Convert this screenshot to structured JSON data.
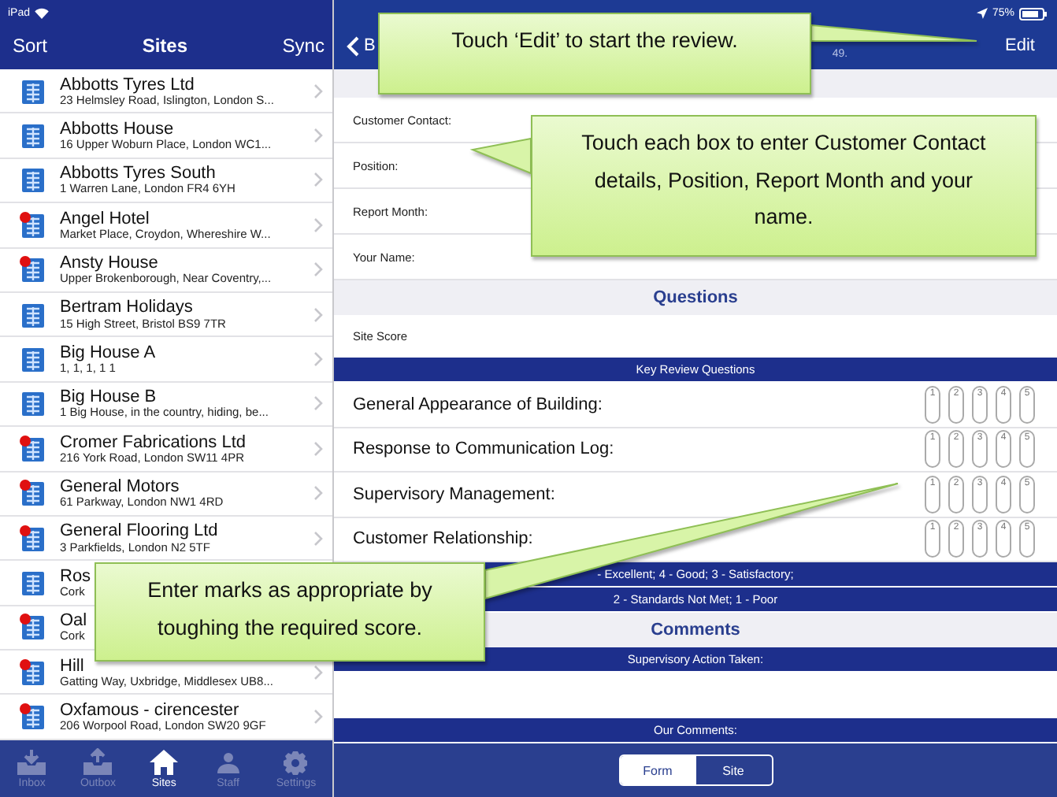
{
  "status_bar": {
    "device": "iPad",
    "battery": "75%"
  },
  "sidebar": {
    "sort": "Sort",
    "title": "Sites",
    "sync": "Sync",
    "items": [
      {
        "name": "Abbotts Tyres Ltd",
        "address": "23 Helmsley Road, Islington, London S...",
        "alert": false
      },
      {
        "name": "Abbotts House",
        "address": "16 Upper Woburn Place, London WC1...",
        "alert": false
      },
      {
        "name": "Abbotts Tyres South",
        "address": "1 Warren Lane, London FR4 6YH",
        "alert": false
      },
      {
        "name": "Angel Hotel",
        "address": "Market Place, Croydon, Whereshire W...",
        "alert": true
      },
      {
        "name": "Ansty House",
        "address": "Upper Brokenborough, Near Coventry,...",
        "alert": true
      },
      {
        "name": "Bertram Holidays",
        "address": "15 High Street, Bristol BS9 7TR",
        "alert": false
      },
      {
        "name": "Big House A",
        "address": "1, 1, 1, 1 1",
        "alert": false
      },
      {
        "name": "Big House B",
        "address": "1 Big House, in the country, hiding, be...",
        "alert": false
      },
      {
        "name": "Cromer Fabrications Ltd",
        "address": "216 York Road, London SW11 4PR",
        "alert": true
      },
      {
        "name": "General Motors",
        "address": "61 Parkway, London NW1 4RD",
        "alert": true
      },
      {
        "name": "General Flooring Ltd",
        "address": "3 Parkfields, London N2 5TF",
        "alert": true
      },
      {
        "name": "Ros",
        "address": "Cork",
        "alert": false
      },
      {
        "name": "Oal",
        "address": "Cork",
        "alert": true
      },
      {
        "name": "Hill",
        "address": "Gatting Way, Uxbridge, Middlesex UB8...",
        "alert": true
      },
      {
        "name": "Oxfamous - cirencester",
        "address": "206 Worpool Road, London SW20 9GF",
        "alert": true
      }
    ],
    "tabs": [
      {
        "label": "Inbox",
        "selected": false,
        "kind": "inbox"
      },
      {
        "label": "Outbox",
        "selected": false,
        "kind": "outbox"
      },
      {
        "label": "Sites",
        "selected": true,
        "kind": "home"
      },
      {
        "label": "Staff",
        "selected": false,
        "kind": "staff"
      },
      {
        "label": "Settings",
        "selected": false,
        "kind": "settings"
      }
    ]
  },
  "detail": {
    "back": "B",
    "subtitle": "49.",
    "edit": "Edit",
    "fields": [
      "Customer Contact:",
      "Position:",
      "Report Month:",
      "Your Name:"
    ],
    "questions_header": "Questions",
    "site_score": "Site Score",
    "key_header": "Key Review Questions",
    "questions": [
      {
        "label": "General Appearance of Building:",
        "scores": [
          {
            "label": "1",
            "selected": false
          },
          {
            "label": "2",
            "selected": false
          },
          {
            "label": "3",
            "selected": false
          },
          {
            "label": "4",
            "selected": false
          },
          {
            "label": "5",
            "selected": false
          }
        ]
      },
      {
        "label": "Response to Communication Log:",
        "scores": [
          {
            "label": "1",
            "selected": false
          },
          {
            "label": "2",
            "selected": false
          },
          {
            "label": "3",
            "selected": false
          },
          {
            "label": "4",
            "selected": false
          },
          {
            "label": "5",
            "selected": false
          }
        ]
      },
      {
        "label": "Supervisory Management:",
        "scores": [
          {
            "label": "1",
            "selected": false
          },
          {
            "label": "2",
            "selected": false
          },
          {
            "label": "3",
            "selected": false
          },
          {
            "label": "4",
            "selected": false
          },
          {
            "label": "5",
            "selected": false
          }
        ]
      },
      {
        "label": "Customer Relationship:",
        "scores": [
          {
            "label": "1",
            "selected": false
          },
          {
            "label": "2",
            "selected": false
          },
          {
            "label": "3",
            "selected": false
          },
          {
            "label": "4",
            "selected": false
          },
          {
            "label": "5",
            "selected": false
          }
        ]
      }
    ],
    "legend": [
      "- Excellent; 4 - Good; 3 - Satisfactory;",
      "2 - Standards Not Met; 1 - Poor"
    ],
    "comments_header": "Comments",
    "action_header": "Supervisory Action Taken:",
    "our_comments_header": "Our Comments:",
    "segments": [
      {
        "label": "Form",
        "selected": true
      },
      {
        "label": "Site",
        "selected": false
      }
    ]
  },
  "callouts": [
    "Touch ‘Edit’ to start the review.",
    "Touch each box to enter Customer Contact details, Position, Report Month and your name.",
    "Enter marks as appropriate by toughing the required score."
  ]
}
